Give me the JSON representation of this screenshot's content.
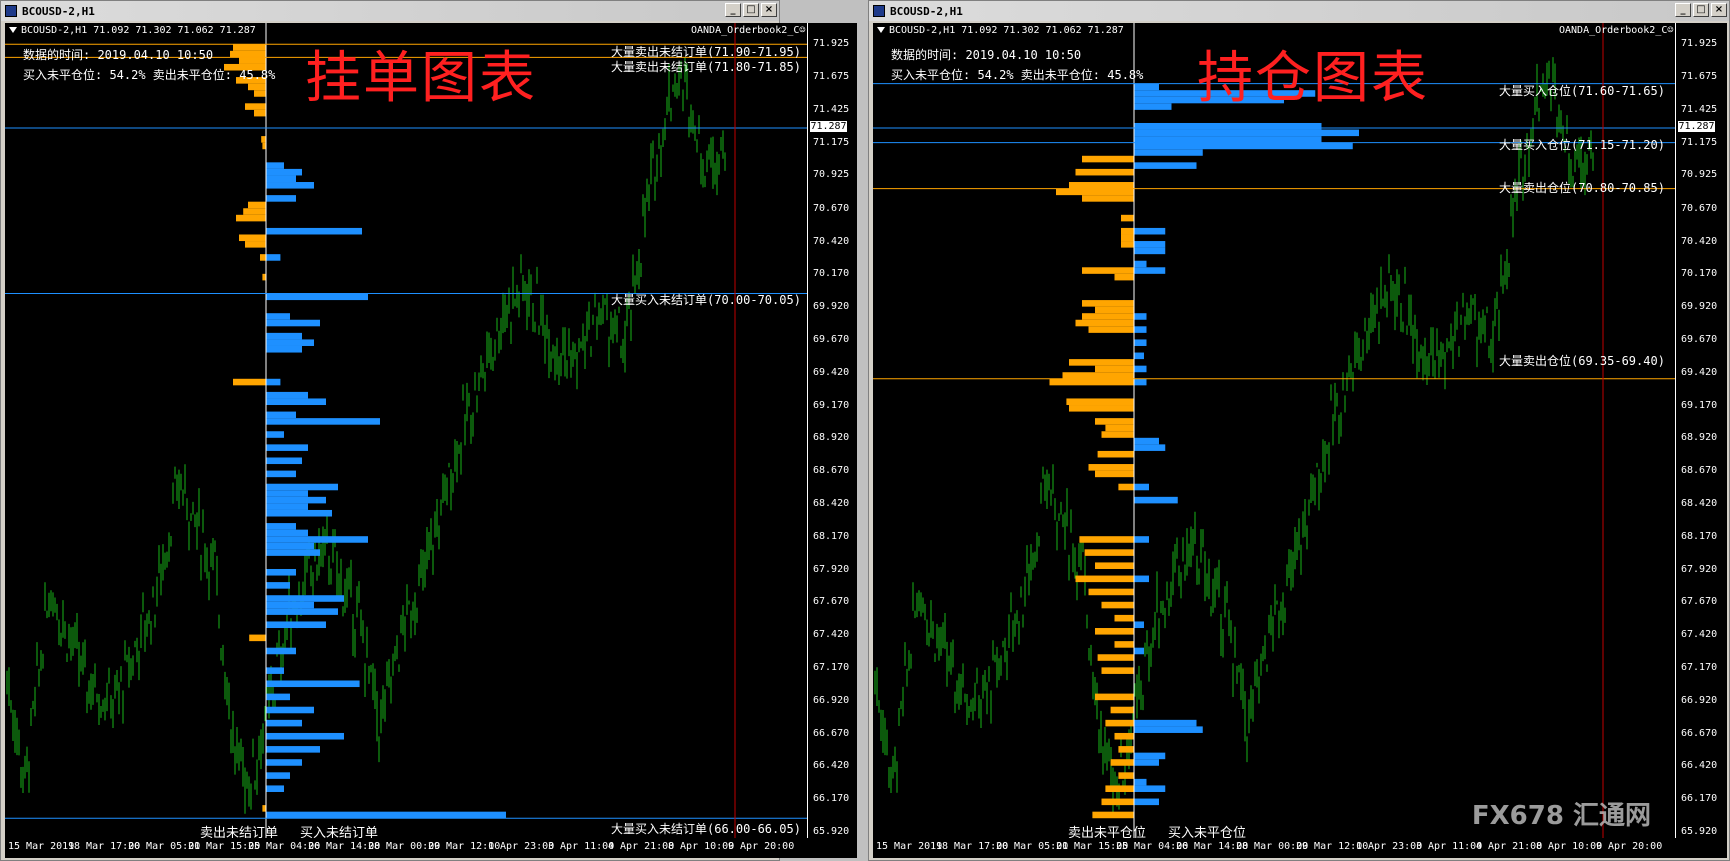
{
  "left": {
    "window_title": "BCOUSD-2,H1",
    "chart_header": "BCOUSD-2,H1  71.092 71.302 71.062 71.287",
    "indicator_name": "OANDA_Orderbook2_C☺",
    "info_time": "数据的时间: 2019.04.10 10:50",
    "info_ratio": "买入未平仓位: 54.2% 卖出未平仓位: 45.8%",
    "big_title": "挂单图表",
    "current_price": "71.287",
    "level_labels": [
      "大量卖出未结订单(71.90-71.95)",
      "大量卖出未结订单(71.80-71.85)",
      "大量买入未结订单(70.00-70.05)",
      "大量买入未结订单(66.00-66.05)"
    ],
    "bottom_left_label": "卖出未结订单",
    "bottom_right_label": "买入未结订单"
  },
  "right": {
    "window_title": "BCOUSD-2,H1",
    "chart_header": "BCOUSD-2,H1  71.092 71.302 71.062 71.287",
    "indicator_name": "OANDA_Orderbook2_C☺",
    "info_time": "数据的时间: 2019.04.10 10:50",
    "info_ratio": "买入未平仓位: 54.2% 卖出未平仓位: 45.8%",
    "big_title": "持仓图表",
    "current_price": "71.287",
    "level_labels": [
      "大量买入仓位(71.60-71.65)",
      "大量买入仓位(71.15-71.20)",
      "大量卖出仓位(70.80-70.85)",
      "大量卖出仓位(69.35-69.40)"
    ],
    "bottom_left_label": "卖出未平仓位",
    "bottom_right_label": "买入未平仓位"
  },
  "price_ticks": [
    "71.925",
    "71.675",
    "71.425",
    "71.175",
    "70.925",
    "70.670",
    "70.420",
    "70.170",
    "69.920",
    "69.670",
    "69.420",
    "69.170",
    "68.920",
    "68.670",
    "68.420",
    "68.170",
    "67.920",
    "67.670",
    "67.420",
    "67.170",
    "66.920",
    "66.670",
    "66.420",
    "66.170",
    "65.920"
  ],
  "time_ticks": [
    "15 Mar 2019",
    "18 Mar 17:00",
    "20 Mar 05:00",
    "21 Mar 15:00",
    "25 Mar 04:00",
    "26 Mar 14:00",
    "28 Mar 00:00",
    "29 Mar 12:00",
    "1 Apr 23:00",
    "3 Apr 11:00",
    "4 Apr 21:00",
    "8 Apr 10:00",
    "9 Apr 20:00"
  ],
  "watermark": "FX678 汇通网",
  "colors": {
    "candle": "#18b418",
    "buy_bar": "#1e90ff",
    "sell_bar": "#ffa500",
    "bg": "#000000",
    "buy_line": "#1e90ff",
    "sell_line": "#ffa500",
    "title": "#ff2020"
  },
  "chart_data": [
    {
      "type": "bar",
      "name": "orderbook",
      "price_range": [
        65.92,
        71.95
      ],
      "sell_orders": [
        [
          71.9,
          0.55
        ],
        [
          71.85,
          0.6
        ],
        [
          71.8,
          0.45
        ],
        [
          71.75,
          0.7
        ],
        [
          71.65,
          0.5
        ],
        [
          71.6,
          0.3
        ],
        [
          71.55,
          0.2
        ],
        [
          71.45,
          0.35
        ],
        [
          71.4,
          0.2
        ],
        [
          71.2,
          0.08
        ],
        [
          71.15,
          0.06
        ],
        [
          70.7,
          0.3
        ],
        [
          70.65,
          0.38
        ],
        [
          70.6,
          0.5
        ],
        [
          70.45,
          0.45
        ],
        [
          70.4,
          0.35
        ],
        [
          70.3,
          0.1
        ],
        [
          70.15,
          0.06
        ],
        [
          69.35,
          0.55
        ],
        [
          67.4,
          0.28
        ],
        [
          66.1,
          0.06
        ]
      ],
      "buy_orders": [
        [
          71.0,
          0.15
        ],
        [
          70.95,
          0.3
        ],
        [
          70.9,
          0.25
        ],
        [
          70.85,
          0.4
        ],
        [
          70.75,
          0.25
        ],
        [
          70.5,
          0.8
        ],
        [
          70.3,
          0.12
        ],
        [
          70.0,
          0.85
        ],
        [
          69.85,
          0.2
        ],
        [
          69.8,
          0.45
        ],
        [
          69.7,
          0.3
        ],
        [
          69.65,
          0.4
        ],
        [
          69.6,
          0.3
        ],
        [
          69.35,
          0.12
        ],
        [
          69.25,
          0.35
        ],
        [
          69.2,
          0.5
        ],
        [
          69.1,
          0.25
        ],
        [
          69.05,
          0.95
        ],
        [
          68.95,
          0.15
        ],
        [
          68.85,
          0.35
        ],
        [
          68.75,
          0.3
        ],
        [
          68.65,
          0.25
        ],
        [
          68.55,
          0.6
        ],
        [
          68.5,
          0.35
        ],
        [
          68.45,
          0.5
        ],
        [
          68.4,
          0.35
        ],
        [
          68.35,
          0.55
        ],
        [
          68.25,
          0.25
        ],
        [
          68.2,
          0.35
        ],
        [
          68.15,
          0.85
        ],
        [
          68.1,
          0.4
        ],
        [
          68.05,
          0.45
        ],
        [
          67.9,
          0.25
        ],
        [
          67.8,
          0.2
        ],
        [
          67.7,
          0.65
        ],
        [
          67.65,
          0.4
        ],
        [
          67.6,
          0.6
        ],
        [
          67.5,
          0.5
        ],
        [
          67.3,
          0.25
        ],
        [
          67.15,
          0.15
        ],
        [
          67.05,
          0.78
        ],
        [
          66.95,
          0.2
        ],
        [
          66.85,
          0.4
        ],
        [
          66.75,
          0.3
        ],
        [
          66.65,
          0.65
        ],
        [
          66.55,
          0.45
        ],
        [
          66.45,
          0.3
        ],
        [
          66.35,
          0.2
        ],
        [
          66.25,
          0.15
        ],
        [
          66.05,
          2.0
        ]
      ]
    },
    {
      "type": "bar",
      "name": "positions",
      "price_range": [
        65.92,
        71.95
      ],
      "long_positions": [
        [
          71.6,
          0.2
        ],
        [
          71.55,
          1.45
        ],
        [
          71.5,
          1.2
        ],
        [
          71.45,
          0.3
        ],
        [
          71.3,
          1.5
        ],
        [
          71.25,
          1.8
        ],
        [
          71.2,
          1.5
        ],
        [
          71.15,
          1.75
        ],
        [
          71.1,
          0.55
        ],
        [
          71.0,
          0.5
        ],
        [
          70.5,
          0.25
        ],
        [
          70.4,
          0.25
        ],
        [
          70.35,
          0.25
        ],
        [
          70.25,
          0.1
        ],
        [
          70.2,
          0.25
        ],
        [
          69.85,
          0.1
        ],
        [
          69.75,
          0.1
        ],
        [
          69.65,
          0.1
        ],
        [
          69.55,
          0.08
        ],
        [
          69.45,
          0.1
        ],
        [
          69.35,
          0.1
        ],
        [
          68.9,
          0.2
        ],
        [
          68.85,
          0.25
        ],
        [
          68.55,
          0.12
        ],
        [
          68.45,
          0.35
        ],
        [
          68.15,
          0.12
        ],
        [
          67.85,
          0.12
        ],
        [
          67.5,
          0.08
        ],
        [
          67.3,
          0.08
        ],
        [
          66.75,
          0.5
        ],
        [
          66.7,
          0.55
        ],
        [
          66.5,
          0.25
        ],
        [
          66.45,
          0.2
        ],
        [
          66.3,
          0.1
        ],
        [
          66.25,
          0.25
        ],
        [
          66.15,
          0.2
        ]
      ],
      "short_positions": [
        [
          71.05,
          0.4
        ],
        [
          70.95,
          0.45
        ],
        [
          70.85,
          0.5
        ],
        [
          70.8,
          0.6
        ],
        [
          70.75,
          0.4
        ],
        [
          70.6,
          0.1
        ],
        [
          70.5,
          0.1
        ],
        [
          70.45,
          0.1
        ],
        [
          70.4,
          0.1
        ],
        [
          70.2,
          0.4
        ],
        [
          70.15,
          0.15
        ],
        [
          69.95,
          0.4
        ],
        [
          69.9,
          0.3
        ],
        [
          69.85,
          0.4
        ],
        [
          69.8,
          0.45
        ],
        [
          69.75,
          0.35
        ],
        [
          69.5,
          0.5
        ],
        [
          69.45,
          0.3
        ],
        [
          69.4,
          0.55
        ],
        [
          69.35,
          0.65
        ],
        [
          69.2,
          0.52
        ],
        [
          69.15,
          0.5
        ],
        [
          69.05,
          0.3
        ],
        [
          69.0,
          0.22
        ],
        [
          68.95,
          0.25
        ],
        [
          68.8,
          0.28
        ],
        [
          68.7,
          0.35
        ],
        [
          68.65,
          0.3
        ],
        [
          68.55,
          0.12
        ],
        [
          68.15,
          0.42
        ],
        [
          68.05,
          0.38
        ],
        [
          67.95,
          0.3
        ],
        [
          67.85,
          0.45
        ],
        [
          67.75,
          0.35
        ],
        [
          67.65,
          0.25
        ],
        [
          67.55,
          0.15
        ],
        [
          67.45,
          0.3
        ],
        [
          67.35,
          0.15
        ],
        [
          67.25,
          0.28
        ],
        [
          67.15,
          0.25
        ],
        [
          66.95,
          0.3
        ],
        [
          66.85,
          0.18
        ],
        [
          66.75,
          0.22
        ],
        [
          66.65,
          0.15
        ],
        [
          66.55,
          0.12
        ],
        [
          66.45,
          0.18
        ],
        [
          66.35,
          0.12
        ],
        [
          66.25,
          0.22
        ],
        [
          66.15,
          0.25
        ],
        [
          66.05,
          0.32
        ]
      ]
    }
  ]
}
